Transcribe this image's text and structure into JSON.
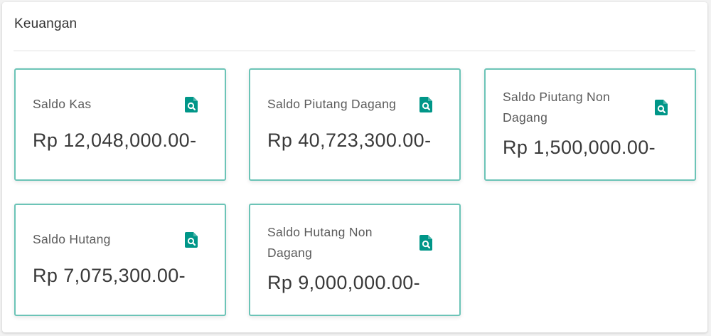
{
  "panel": {
    "title": "Keuangan"
  },
  "colors": {
    "accent": "#009688",
    "card_border": "#6cc4b7"
  },
  "cards": [
    {
      "label": "Saldo Kas",
      "value": "Rp 12,048,000.00-",
      "icon": "file-search-icon"
    },
    {
      "label": "Saldo Piutang Dagang",
      "value": "Rp 40,723,300.00-",
      "icon": "file-search-icon"
    },
    {
      "label": "Saldo Piutang Non Dagang",
      "value": "Rp 1,500,000.00-",
      "icon": "file-search-icon"
    },
    {
      "label": "Saldo Hutang",
      "value": "Rp 7,075,300.00-",
      "icon": "file-search-icon"
    },
    {
      "label": "Saldo Hutang Non Dagang",
      "value": "Rp 9,000,000.00-",
      "icon": "file-search-icon"
    }
  ]
}
